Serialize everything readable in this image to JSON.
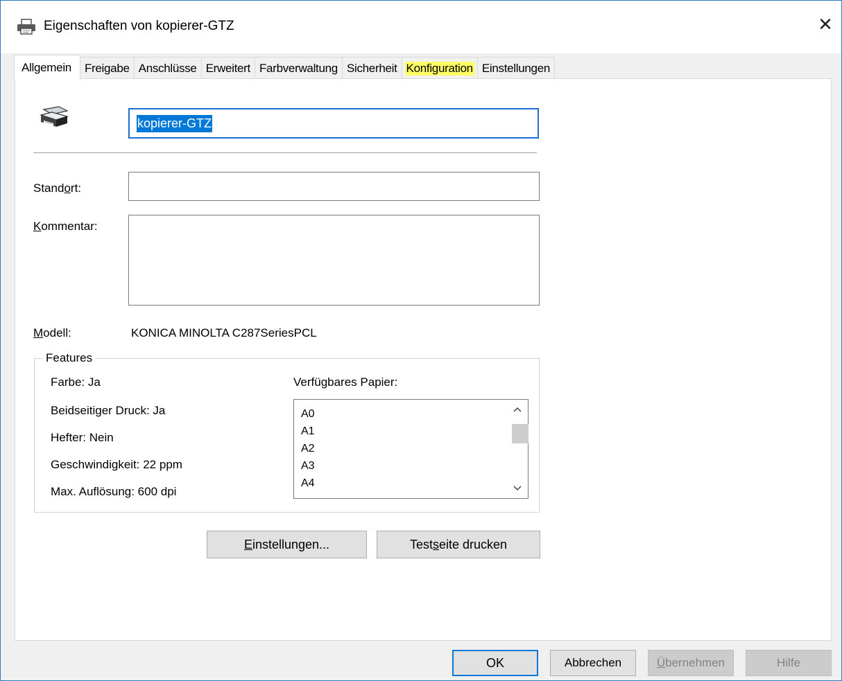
{
  "window": {
    "title": "Eigenschaften von kopierer-GTZ",
    "close_glyph": "✕"
  },
  "tabs": [
    {
      "label": "Allgemein",
      "active": true
    },
    {
      "label": "Freigabe"
    },
    {
      "label": "Anschlüsse"
    },
    {
      "label": "Erweitert"
    },
    {
      "label": "Farbverwaltung"
    },
    {
      "label": "Sicherheit"
    },
    {
      "label": "Konfiguration",
      "highlighted": true
    },
    {
      "label": "Einstellungen"
    }
  ],
  "general": {
    "printer_name": "kopierer-GTZ",
    "location_label_pre": "Stand",
    "location_label_ul": "o",
    "location_label_post": "rt:",
    "location_value": "",
    "comment_label_ul": "K",
    "comment_label_post": "ommentar:",
    "comment_value": "",
    "model_label_ul": "M",
    "model_label_post": "odell:",
    "model_value": "KONICA MINOLTA C287SeriesPCL"
  },
  "features": {
    "legend": "Features",
    "color": "Farbe: Ja",
    "duplex": "Beidseitiger Druck: Ja",
    "stapler": "Hefter: Nein",
    "speed": "Geschwindigkeit: 22 ppm",
    "resolution": "Max. Auflösung: 600 dpi",
    "paper_label": "Verfügbares Papier:",
    "paper_items": [
      "A0",
      "A1",
      "A2",
      "A3",
      "A4"
    ]
  },
  "buttons": {
    "settings_ul": "E",
    "settings_post": "instellungen...",
    "testpage_pre": "Test",
    "testpage_ul": "s",
    "testpage_post": "eite drucken",
    "ok": "OK",
    "cancel": "Abbrechen",
    "apply_ul": "Ü",
    "apply_post": "bernehmen",
    "help": "Hilfe"
  },
  "colors": {
    "accent": "#0078d7",
    "highlight": "#ffff66"
  }
}
